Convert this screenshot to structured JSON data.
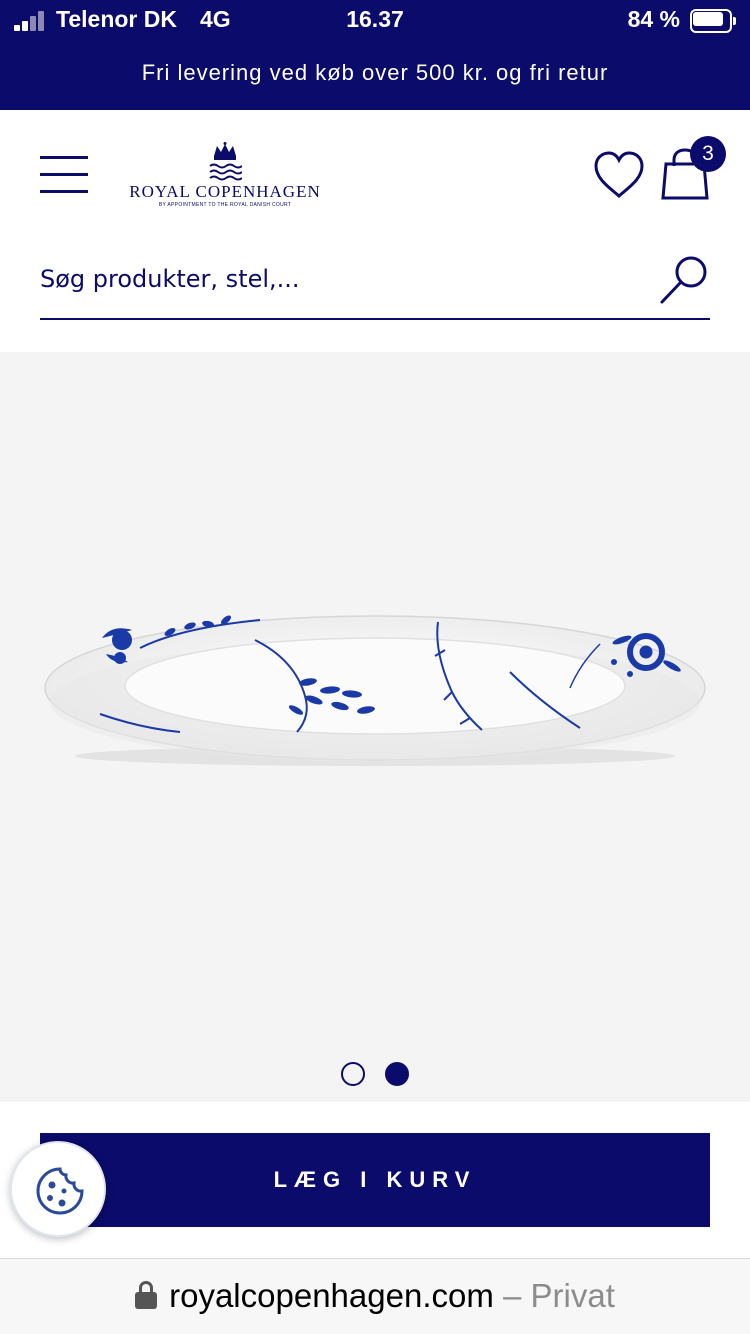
{
  "status_bar": {
    "carrier": "Telenor DK",
    "network": "4G",
    "time": "16.37",
    "battery_percent_text": "84 %",
    "battery_level": 0.84
  },
  "promo_banner": {
    "text": "Fri levering ved køb over 500 kr. og fri retur"
  },
  "header": {
    "logo": {
      "name": "ROYAL COPENHAGEN",
      "tagline": "BY APPOINTMENT TO THE ROYAL DANISH COURT",
      "icon": "crown-waves-logo"
    },
    "menu_icon": "hamburger-menu-icon",
    "wishlist_icon": "heart-icon",
    "cart_icon": "shopping-bag-icon",
    "cart_count": "3"
  },
  "search": {
    "placeholder": "Søg produkter, stel,...",
    "icon": "magnifier-icon"
  },
  "gallery": {
    "image": "blue-fluted-oval-serving-dish",
    "slide_count": 2,
    "active_slide": 2
  },
  "actions": {
    "add_to_cart_label": "LÆG I KURV"
  },
  "cookie_button": {
    "icon": "cookie-icon"
  },
  "browser": {
    "domain": "royalcopenhagen.com",
    "mode": " – Privat",
    "lock_icon": "lock-icon"
  },
  "colors": {
    "brand_navy": "#0b0b6b",
    "gallery_bg": "#f4f4f4",
    "plate_blue": "#1a3aa8"
  }
}
